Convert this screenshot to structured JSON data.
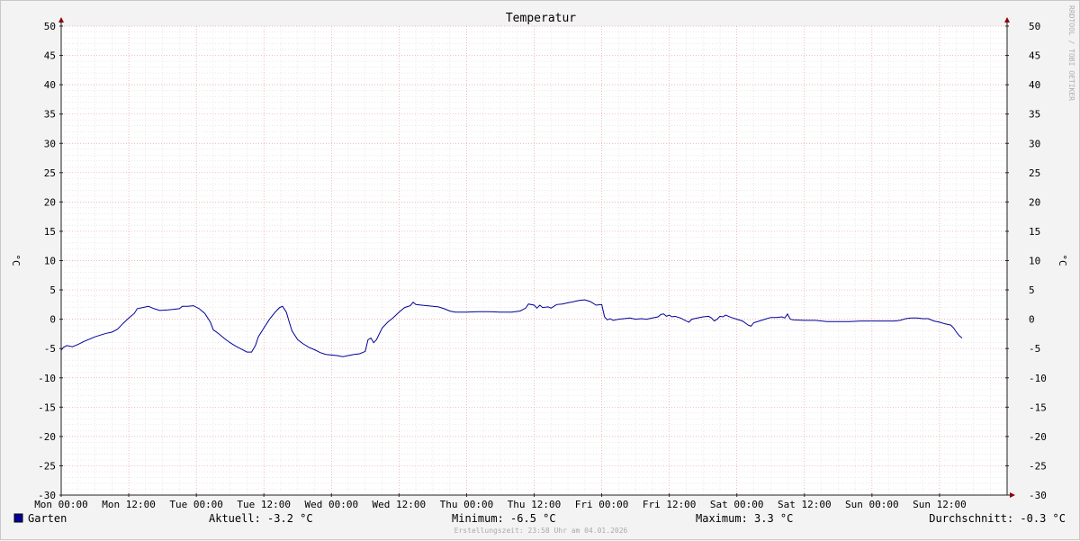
{
  "chart_data": {
    "type": "line",
    "title": "Temperatur",
    "ylabel_left": "°C",
    "ylabel_right": "°C",
    "ylim": [
      -30,
      50
    ],
    "yticks": [
      50,
      45,
      40,
      35,
      30,
      25,
      20,
      15,
      10,
      5,
      0,
      -5,
      -10,
      -15,
      -20,
      -25,
      -30
    ],
    "xlim_hours": [
      0,
      168
    ],
    "xticks": [
      {
        "label": "Mon 00:00",
        "hour": 0
      },
      {
        "label": "Mon 12:00",
        "hour": 12
      },
      {
        "label": "Tue 00:00",
        "hour": 24
      },
      {
        "label": "Tue 12:00",
        "hour": 36
      },
      {
        "label": "Wed 00:00",
        "hour": 48
      },
      {
        "label": "Wed 12:00",
        "hour": 60
      },
      {
        "label": "Thu 00:00",
        "hour": 72
      },
      {
        "label": "Thu 12:00",
        "hour": 84
      },
      {
        "label": "Fri 00:00",
        "hour": 96
      },
      {
        "label": "Fri 12:00",
        "hour": 108
      },
      {
        "label": "Sat 00:00",
        "hour": 120
      },
      {
        "label": "Sat 12:00",
        "hour": 132
      },
      {
        "label": "Sun 00:00",
        "hour": 144
      },
      {
        "label": "Sun 12:00",
        "hour": 156
      }
    ],
    "grid": true,
    "series": [
      {
        "name": "Garten",
        "color": "#000099",
        "points": [
          [
            0,
            -5.3
          ],
          [
            0.4,
            -4.8
          ],
          [
            1,
            -4.5
          ],
          [
            2,
            -4.7
          ],
          [
            3,
            -4.3
          ],
          [
            4,
            -3.8
          ],
          [
            5,
            -3.4
          ],
          [
            6,
            -3.0
          ],
          [
            7,
            -2.7
          ],
          [
            8,
            -2.4
          ],
          [
            9,
            -2.2
          ],
          [
            10,
            -1.7
          ],
          [
            11,
            -0.7
          ],
          [
            12,
            0.2
          ],
          [
            13,
            1.0
          ],
          [
            13.5,
            1.8
          ],
          [
            14.5,
            2.0
          ],
          [
            15.5,
            2.2
          ],
          [
            16.5,
            1.8
          ],
          [
            17.5,
            1.5
          ],
          [
            19,
            1.6
          ],
          [
            20,
            1.7
          ],
          [
            21,
            1.8
          ],
          [
            21.5,
            2.2
          ],
          [
            22.5,
            2.2
          ],
          [
            23.5,
            2.3
          ],
          [
            24.5,
            1.8
          ],
          [
            25.5,
            1.0
          ],
          [
            26.5,
            -0.5
          ],
          [
            27,
            -1.8
          ],
          [
            28,
            -2.5
          ],
          [
            29,
            -3.3
          ],
          [
            30,
            -4.0
          ],
          [
            31,
            -4.6
          ],
          [
            32,
            -5.1
          ],
          [
            33,
            -5.6
          ],
          [
            33.8,
            -5.6
          ],
          [
            34.5,
            -4.5
          ],
          [
            35,
            -3.0
          ],
          [
            36,
            -1.5
          ],
          [
            37,
            0.0
          ],
          [
            38,
            1.2
          ],
          [
            38.8,
            2.0
          ],
          [
            39.3,
            2.2
          ],
          [
            40,
            1.2
          ],
          [
            40.5,
            -0.5
          ],
          [
            41,
            -2.0
          ],
          [
            42,
            -3.5
          ],
          [
            43,
            -4.2
          ],
          [
            44,
            -4.8
          ],
          [
            45,
            -5.2
          ],
          [
            46,
            -5.7
          ],
          [
            47,
            -6.0
          ],
          [
            48,
            -6.1
          ],
          [
            49,
            -6.2
          ],
          [
            50,
            -6.4
          ],
          [
            51,
            -6.2
          ],
          [
            52,
            -6.0
          ],
          [
            53,
            -5.9
          ],
          [
            54,
            -5.5
          ],
          [
            54.5,
            -3.5
          ],
          [
            55,
            -3.2
          ],
          [
            55.5,
            -4.0
          ],
          [
            56,
            -3.5
          ],
          [
            57,
            -1.5
          ],
          [
            58,
            -0.5
          ],
          [
            59,
            0.3
          ],
          [
            60,
            1.2
          ],
          [
            61,
            2.0
          ],
          [
            62,
            2.3
          ],
          [
            62.5,
            2.9
          ],
          [
            63,
            2.5
          ],
          [
            64,
            2.4
          ],
          [
            65,
            2.3
          ],
          [
            66,
            2.2
          ],
          [
            67,
            2.1
          ],
          [
            68,
            1.8
          ],
          [
            69,
            1.4
          ],
          [
            70,
            1.2
          ],
          [
            72,
            1.2
          ],
          [
            74,
            1.3
          ],
          [
            76,
            1.3
          ],
          [
            78,
            1.2
          ],
          [
            80,
            1.2
          ],
          [
            81.5,
            1.4
          ],
          [
            82.5,
            1.9
          ],
          [
            83,
            2.6
          ],
          [
            84,
            2.4
          ],
          [
            84.5,
            1.9
          ],
          [
            85,
            2.4
          ],
          [
            85.5,
            2.0
          ],
          [
            86.5,
            2.1
          ],
          [
            87,
            1.9
          ],
          [
            88,
            2.5
          ],
          [
            89,
            2.6
          ],
          [
            90,
            2.8
          ],
          [
            91,
            3.0
          ],
          [
            92,
            3.2
          ],
          [
            93,
            3.3
          ],
          [
            94,
            3.0
          ],
          [
            95,
            2.4
          ],
          [
            96,
            2.5
          ],
          [
            96.5,
            0.4
          ],
          [
            97,
            -0.1
          ],
          [
            97.5,
            0.1
          ],
          [
            98,
            -0.2
          ],
          [
            99,
            0.0
          ],
          [
            100,
            0.1
          ],
          [
            101,
            0.2
          ],
          [
            102,
            0.0
          ],
          [
            103,
            0.1
          ],
          [
            104,
            0.0
          ],
          [
            105,
            0.2
          ],
          [
            106,
            0.4
          ],
          [
            106.5,
            0.8
          ],
          [
            107,
            0.9
          ],
          [
            107.5,
            0.5
          ],
          [
            108,
            0.7
          ],
          [
            108.5,
            0.4
          ],
          [
            109,
            0.5
          ],
          [
            110,
            0.2
          ],
          [
            111,
            -0.3
          ],
          [
            111.5,
            -0.5
          ],
          [
            112,
            0.0
          ],
          [
            113,
            0.2
          ],
          [
            114,
            0.4
          ],
          [
            115,
            0.5
          ],
          [
            115.5,
            0.2
          ],
          [
            116,
            -0.3
          ],
          [
            116.5,
            0.0
          ],
          [
            117,
            0.5
          ],
          [
            117.5,
            0.4
          ],
          [
            118,
            0.7
          ],
          [
            119,
            0.3
          ],
          [
            120,
            0.0
          ],
          [
            121,
            -0.3
          ],
          [
            122,
            -1.0
          ],
          [
            122.5,
            -1.2
          ],
          [
            123,
            -0.6
          ],
          [
            124,
            -0.3
          ],
          [
            125,
            0.0
          ],
          [
            126,
            0.3
          ],
          [
            127,
            0.3
          ],
          [
            128,
            0.4
          ],
          [
            128.5,
            0.2
          ],
          [
            129,
            0.9
          ],
          [
            129.5,
            0.0
          ],
          [
            130,
            -0.1
          ],
          [
            132,
            -0.2
          ],
          [
            134,
            -0.2
          ],
          [
            136,
            -0.4
          ],
          [
            138,
            -0.4
          ],
          [
            140,
            -0.4
          ],
          [
            142,
            -0.3
          ],
          [
            144,
            -0.3
          ],
          [
            146,
            -0.3
          ],
          [
            148,
            -0.3
          ],
          [
            149,
            -0.2
          ],
          [
            150,
            0.1
          ],
          [
            151,
            0.2
          ],
          [
            152,
            0.2
          ],
          [
            153,
            0.1
          ],
          [
            154,
            0.1
          ],
          [
            155,
            -0.3
          ],
          [
            156,
            -0.5
          ],
          [
            157,
            -0.8
          ],
          [
            158,
            -1.0
          ],
          [
            158.5,
            -1.5
          ],
          [
            159,
            -2.2
          ],
          [
            159.5,
            -2.8
          ],
          [
            160,
            -3.2
          ]
        ]
      }
    ]
  },
  "legend": {
    "series_name": "Garten",
    "swatch_color": "#000099",
    "current": "Aktuell: -3.2 °C",
    "minimum": "Minimum: -6.5 °C",
    "maximum": "Maximum: 3.3 °C",
    "average": "Durchschnitt: -0.3 °C"
  },
  "footer": {
    "created": "Erstellungszeit: 23:58 Uhr am 04.01.2026"
  },
  "watermark": "RRDTOOL / TOBI OETIKER"
}
